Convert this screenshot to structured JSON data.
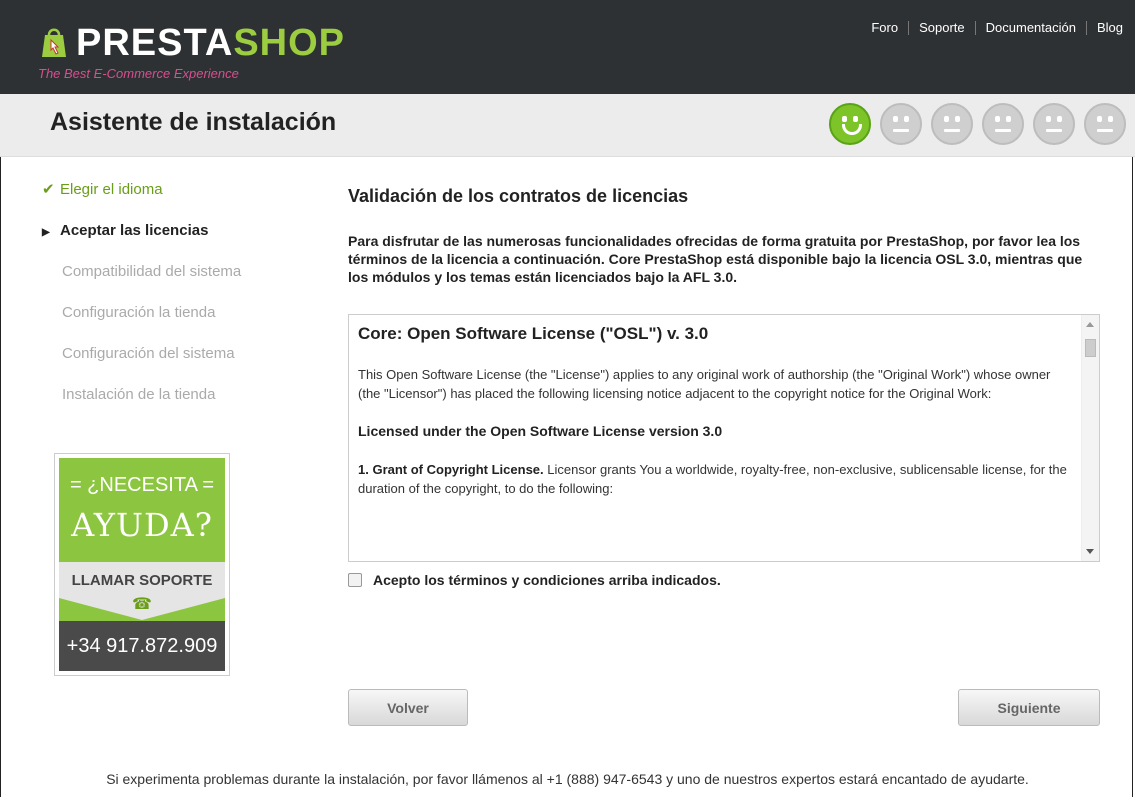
{
  "header": {
    "brand_a": "PRESTA",
    "brand_b": "SHOP",
    "tagline": "The Best E-Commerce Experience",
    "nav": [
      "Foro",
      "Soporte",
      "Documentación",
      "Blog"
    ]
  },
  "title": "Asistente de instalación",
  "progress": {
    "current_step": 1,
    "total_steps": 6
  },
  "steps": [
    {
      "label": "Elegir el idioma",
      "state": "done"
    },
    {
      "label": "Aceptar las licencias",
      "state": "current"
    },
    {
      "label": "Compatibilidad del sistema",
      "state": "pending"
    },
    {
      "label": "Configuración la tienda",
      "state": "pending"
    },
    {
      "label": "Configuración del sistema",
      "state": "pending"
    },
    {
      "label": "Instalación de la tienda",
      "state": "pending"
    }
  ],
  "help": {
    "line1": "= ¿NECESITA =",
    "line2": "AYUDA?",
    "call": "LLAMAR SOPORTE",
    "phone_icon": "☎",
    "number": "+34 917.872.909"
  },
  "main": {
    "heading": "Validación de los contratos de licencias",
    "intro": "Para disfrutar de las numerosas funcionalidades ofrecidas de forma gratuita por PrestaShop, por favor lea los términos de la licencia a continuación. Core PrestaShop está disponible bajo la licencia OSL 3.0, mientras que los módulos y los temas están licenciados bajo la AFL 3.0."
  },
  "license": {
    "title": "Core: Open Software License (\"OSL\") v. 3.0",
    "para1": "This Open Software License (the \"License\") applies to any original work of authorship (the \"Original Work\") whose owner (the \"Licensor\") has placed the following licensing notice adjacent to the copyright notice for the Original Work:",
    "subheading": "Licensed under the Open Software License version 3.0",
    "para2_bold": "1. Grant of Copyright License.",
    "para2_rest": " Licensor grants You a worldwide, royalty-free, non-exclusive, sublicensable license, for the duration of the copyright, to do the following:"
  },
  "accept_label": "Acepto los términos y condiciones arriba indicados.",
  "buttons": {
    "back": "Volver",
    "next": "Siguiente"
  },
  "footer": "Si experimenta problemas durante la instalación, por favor llámenos al +1 (888) 947-6543 y uno de nuestros expertos estará encantado de ayudarte.",
  "colors": {
    "accent": "#7dc428",
    "topbar": "#2e3133",
    "help_bg": "#8cc640",
    "pink": "#d84e91"
  }
}
